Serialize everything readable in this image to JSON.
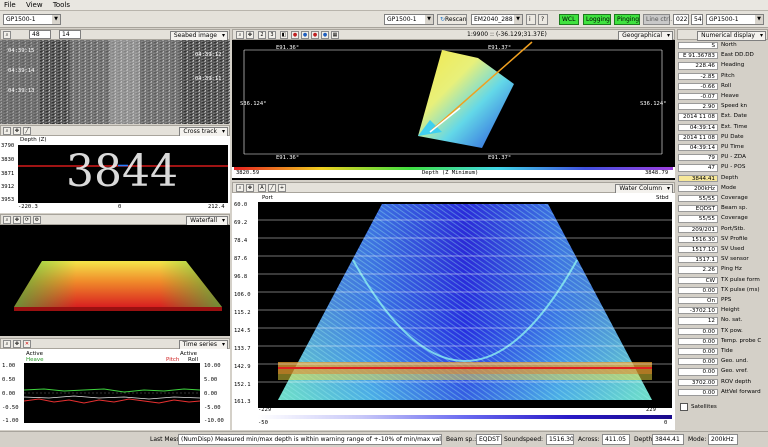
{
  "menu": [
    "File",
    "View",
    "Tools"
  ],
  "toolbar": {
    "sounder_left": "GP1500-1",
    "sounder_mid": "GP1500-1",
    "rescan": "Rescan",
    "port_combo": "EM2040_288",
    "wcl": "WCL",
    "logging": "Logging",
    "pinging": "Pinging",
    "line_ctrl": "Line ctrl.",
    "line_num": "0226",
    "line_suffix": "54",
    "sounder_right": "GP1500-1"
  },
  "seabed": {
    "header_values": [
      "48",
      "14"
    ],
    "combo": "Seabed image",
    "times": [
      "04:39:15",
      "04:39:14",
      "04:39:13",
      "04:39:12",
      "04:39:11"
    ]
  },
  "crosstrack": {
    "combo": "Cross track",
    "depth_label": "Depth (Z)",
    "y_ticks": [
      "3790",
      "3830",
      "3871",
      "3912",
      "3953"
    ],
    "big_depth": "3844",
    "x_ticks": [
      "-220.3",
      "0",
      "212.4"
    ]
  },
  "waterfall": {
    "combo": "Waterfall"
  },
  "timeseries": {
    "combo": "Time series",
    "legend_left_active": "Active",
    "legend_left_series": "Heave",
    "legend_right_active": "Active",
    "legend_right_pitch": "Pitch",
    "legend_right_roll": "Roll",
    "left_ticks": [
      "1.00",
      "0.50",
      "0.00",
      "-0.50",
      "-1.00"
    ],
    "right_ticks": [
      "10.00",
      "5.00",
      "0.00",
      "-5.00",
      "-10.00"
    ]
  },
  "geo": {
    "toolbar_text": "1:9900 :: (-36.129;31.37E)",
    "combo": "Geographical",
    "lat_top_left": "E91.36°",
    "lat_top_right": "E91.37°",
    "lon_left": "S36.124°",
    "lon_right": "S36.124°",
    "lat_bot_left": "E91.36°",
    "lat_bot_right": "E91.37°",
    "scale_min": "3820.59",
    "scale_label": "Depth (Z Minimum)",
    "scale_max": "3848.79"
  },
  "watercolumn": {
    "combo": "Water Column",
    "port": "Port",
    "stbd": "Stbd",
    "y_ticks": [
      "60.0",
      "69.2",
      "78.4",
      "87.6",
      "96.8",
      "106.0",
      "115.2",
      "124.5",
      "133.7",
      "142.9",
      "152.1",
      "161.3"
    ],
    "x_left": "-229",
    "x_right": "229",
    "scale_min": "-50",
    "scale_max": "0"
  },
  "numerical": {
    "combo": "Numerical display",
    "rows": [
      {
        "value": "S 4292509.12",
        "label": "North"
      },
      {
        "value": "E 91.36783",
        "label": "East DD.DD"
      },
      {
        "value": "228.46",
        "label": "Heading"
      },
      {
        "value": "-2.85",
        "label": "Pitch"
      },
      {
        "value": "-0.66",
        "label": "Roll"
      },
      {
        "value": "-0.07",
        "label": "Heave"
      },
      {
        "value": "2.90",
        "label": "Speed kn"
      },
      {
        "value": "2014 11 08",
        "label": "Ext. Date"
      },
      {
        "value": "04:39:14",
        "label": "Ext. Time"
      },
      {
        "value": "2014 11 08",
        "label": "PU Date"
      },
      {
        "value": "04:39:14",
        "label": "PU Time"
      },
      {
        "value": "79",
        "label": "PU - ZDA"
      },
      {
        "value": "47",
        "label": "PU - POS"
      },
      {
        "value": "3844.41",
        "label": "Depth",
        "hl": true
      },
      {
        "value": "200kHz",
        "label": "Mode"
      },
      {
        "value": "55/55",
        "label": "Coverage"
      },
      {
        "value": "EQDST",
        "label": "Beam sp."
      },
      {
        "value": "55/55",
        "label": "Coverage"
      },
      {
        "value": "209/201",
        "label": "Port/Stb."
      },
      {
        "value": "1516.30",
        "label": "SV Profile"
      },
      {
        "value": "1517.10",
        "label": "SV Used"
      },
      {
        "value": "1517.1",
        "label": "SV sensor"
      },
      {
        "value": "2.26",
        "label": "Ping Hz"
      },
      {
        "value": "CW",
        "label": "TX pulse form"
      },
      {
        "value": "0.00",
        "label": "TX pulse (ms)"
      },
      {
        "value": "On",
        "label": "PPS"
      },
      {
        "value": "-3702.10",
        "label": "Height"
      },
      {
        "value": "12",
        "label": "No. sat."
      },
      {
        "value": "0.00",
        "label": "TX pow."
      },
      {
        "value": "0.00",
        "label": "Temp. probe C"
      },
      {
        "value": "0.00",
        "label": "Tide"
      },
      {
        "value": "0.00",
        "label": "Geo. und."
      },
      {
        "value": "0.00",
        "label": "Geo. vref."
      },
      {
        "value": "3702.00",
        "label": "ROV depth"
      },
      {
        "value": "0.00",
        "label": "AttVel forward"
      }
    ],
    "satellites": "Satellites"
  },
  "status": {
    "last_mess_label": "Last Mess.:",
    "message": "(NumDisp) Measured min/max depth is within warning range of +-10% of min/max values",
    "beam_sp_label": "Beam sp.:",
    "beam_sp": "EQDST",
    "soundspeed_label": "Soundspeed:",
    "soundspeed": "1516.30",
    "across_label": "Across:",
    "across": "411.05",
    "depth_label": "Depth:",
    "depth": "3844.41",
    "mode_label": "Mode:",
    "mode": "200kHz"
  }
}
